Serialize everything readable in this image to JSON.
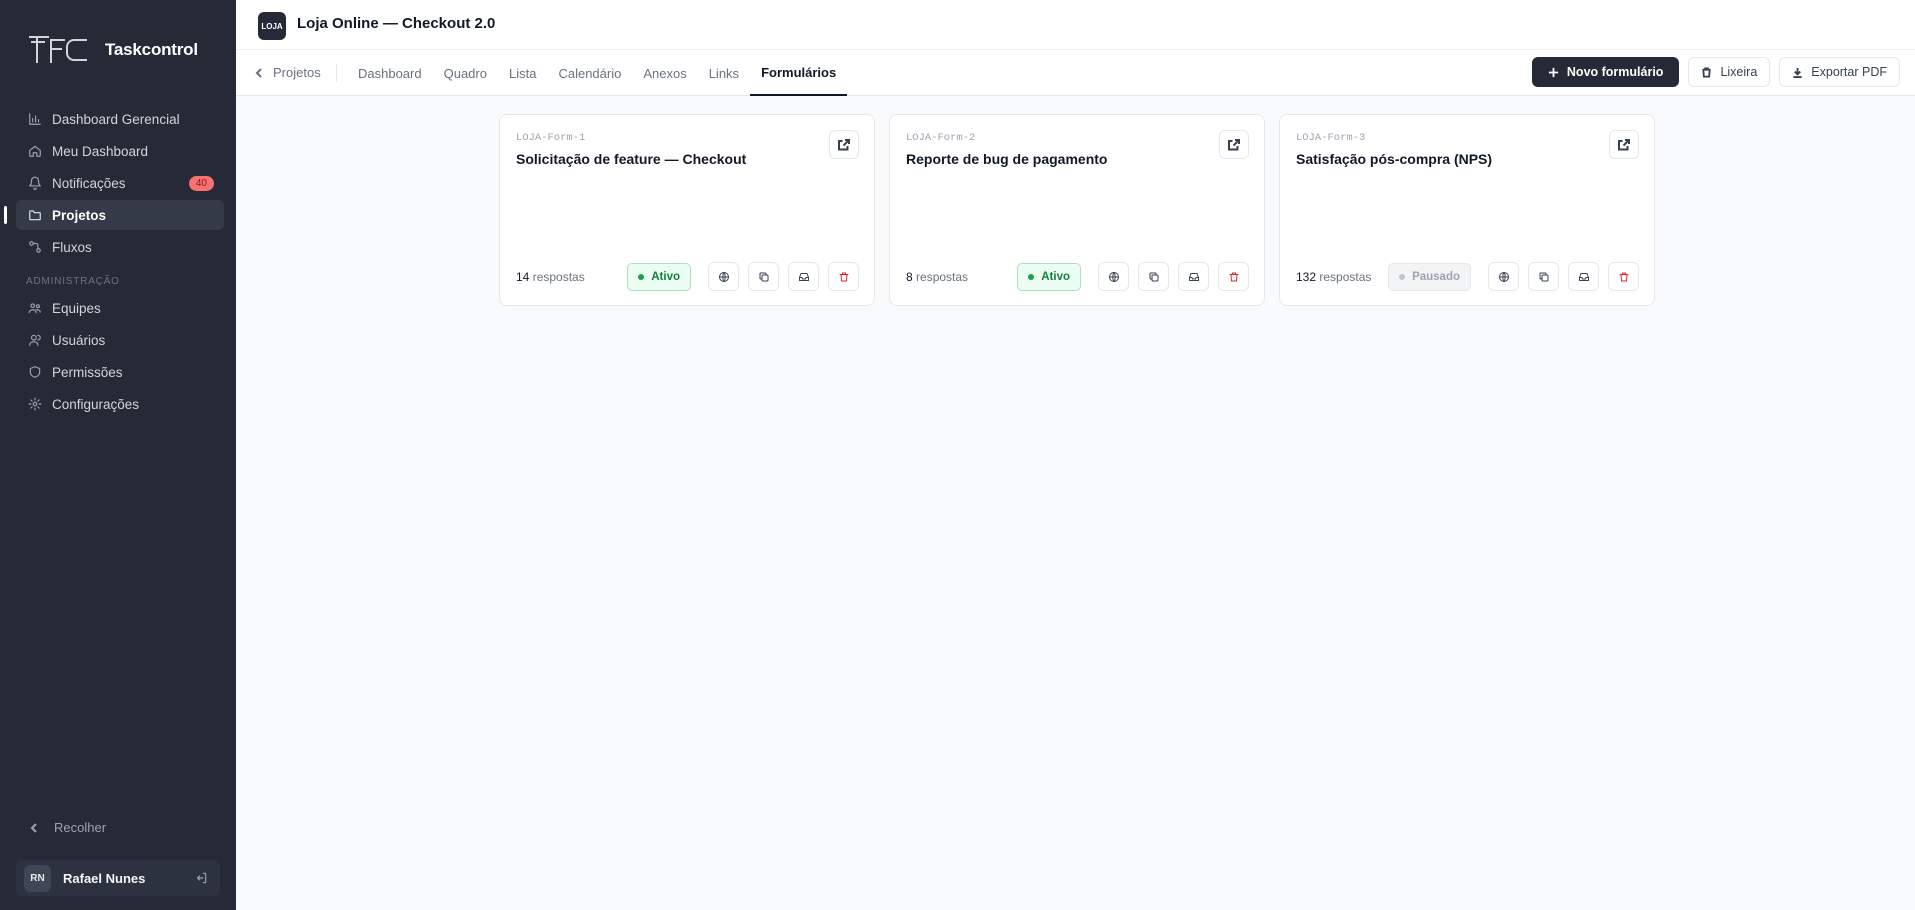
{
  "app": {
    "name": "Taskcontrol"
  },
  "sidebar": {
    "items": [
      {
        "label": "Dashboard Gerencial",
        "icon": "bar-chart-icon"
      },
      {
        "label": "Meu Dashboard",
        "icon": "home-icon"
      },
      {
        "label": "Notificações",
        "icon": "bell-icon",
        "badge": "40"
      },
      {
        "label": "Projetos",
        "icon": "folder-icon",
        "active": true
      },
      {
        "label": "Fluxos",
        "icon": "workflow-icon"
      }
    ],
    "admin_label": "ADMINISTRAÇÃO",
    "admin_items": [
      {
        "label": "Equipes",
        "icon": "users-group-icon"
      },
      {
        "label": "Usuários",
        "icon": "user-icon"
      },
      {
        "label": "Permissões",
        "icon": "shield-icon"
      },
      {
        "label": "Configurações",
        "icon": "gear-icon"
      }
    ],
    "collapse_label": "Recolher",
    "user": {
      "initials": "RN",
      "name": "Rafael Nunes"
    }
  },
  "header": {
    "project_badge": "LOJA",
    "project_title": "Loja Online — Checkout 2.0"
  },
  "tabs": {
    "back_label": "Projetos",
    "items": [
      "Dashboard",
      "Quadro",
      "Lista",
      "Calendário",
      "Anexos",
      "Links",
      "Formulários"
    ],
    "active": "Formulários"
  },
  "actions": {
    "new_form": "Novo formulário",
    "trash": "Lixeira",
    "export": "Exportar PDF"
  },
  "forms": [
    {
      "key": "LOJA-Form-1",
      "title": "Solicitação de feature — Checkout",
      "responses_count": "14",
      "responses_label": "respostas",
      "status": "Ativo"
    },
    {
      "key": "LOJA-Form-2",
      "title": "Reporte de bug de pagamento",
      "responses_count": "8",
      "responses_label": "respostas",
      "status": "Ativo"
    },
    {
      "key": "LOJA-Form-3",
      "title": "Satisfação pós-compra (NPS)",
      "responses_count": "132",
      "responses_label": "respostas",
      "status": "Pausado"
    }
  ],
  "colors": {
    "sidebar_bg": "#252a36",
    "accent": "#252a36",
    "badge": "#f87171",
    "active_status": "#16a34a",
    "danger": "#dc2626"
  }
}
